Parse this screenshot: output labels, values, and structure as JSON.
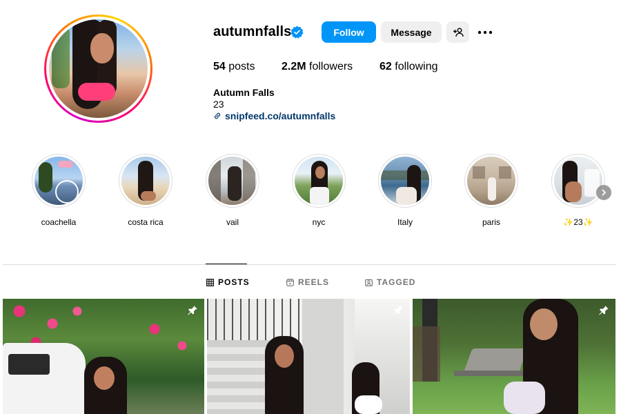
{
  "profile": {
    "username": "autumnfalls",
    "verified": true,
    "follow_label": "Follow",
    "message_label": "Message",
    "posts_count": "54",
    "posts_label": "posts",
    "followers_count": "2.2M",
    "followers_label": "followers",
    "following_count": "62",
    "following_label": "following",
    "full_name": "Autumn Falls",
    "bio": "23",
    "link": "snipfeed.co/autumnfalls"
  },
  "highlights": [
    {
      "label": "coachella"
    },
    {
      "label": "costa rica"
    },
    {
      "label": "vail"
    },
    {
      "label": "nyc"
    },
    {
      "label": "Italy"
    },
    {
      "label": "paris"
    },
    {
      "label": "✨23✨"
    }
  ],
  "tabs": [
    {
      "label": "POSTS",
      "active": true,
      "icon": "grid-icon"
    },
    {
      "label": "REELS",
      "active": false,
      "icon": "reels-icon"
    },
    {
      "label": "TAGGED",
      "active": false,
      "icon": "tagged-icon"
    }
  ],
  "colors": {
    "follow_button": "#0095f6",
    "verified_badge": "#0095f6",
    "link_text": "#00376b",
    "secondary_button": "#efefef"
  },
  "posts": [
    {
      "pinned": true,
      "icon": "pin-icon"
    },
    {
      "pinned": true,
      "icon": "pin-icon"
    },
    {
      "pinned": true,
      "icon": "pin-icon"
    }
  ]
}
